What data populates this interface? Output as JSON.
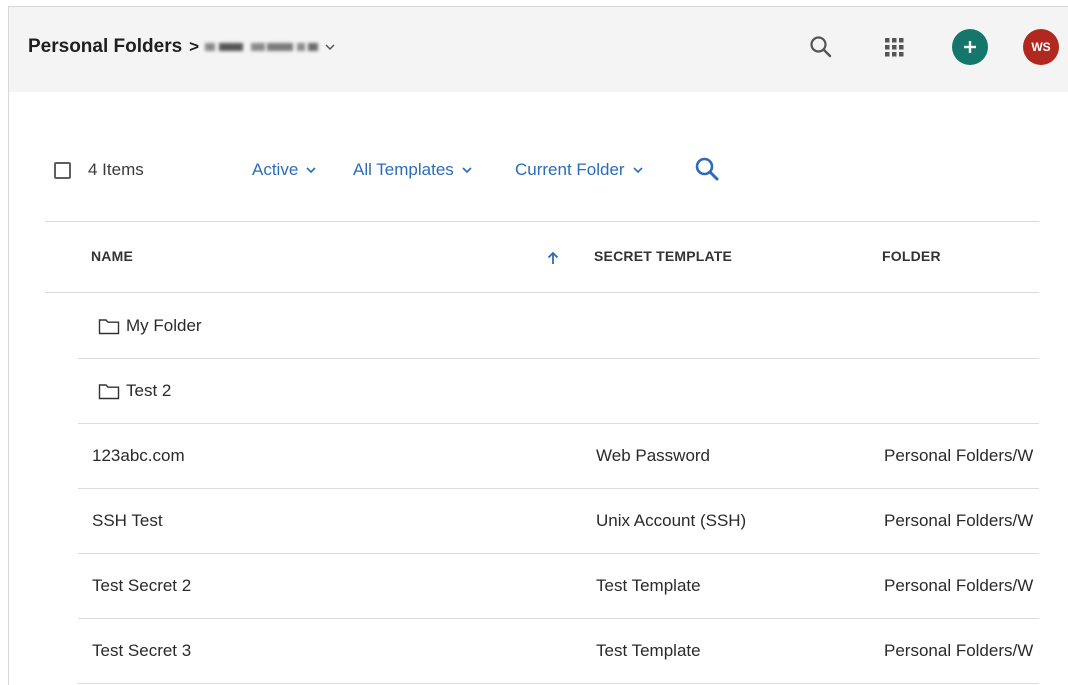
{
  "header": {
    "breadcrumb_root": "Personal Folders",
    "breadcrumb_separator": ">",
    "avatar_initials": "WS",
    "add_color": "#15776b",
    "avatar_color": "#b0281f"
  },
  "toolbar": {
    "items_count": "4 Items",
    "status_filter": "Active",
    "template_filter": "All Templates",
    "folder_filter": "Current Folder",
    "accent_color": "#2b6cb8"
  },
  "table": {
    "columns": {
      "name": "NAME",
      "template": "SECRET TEMPLATE",
      "folder": "FOLDER"
    },
    "sort": "name-ascending",
    "rows": [
      {
        "type": "folder",
        "name": "My Folder",
        "template": "",
        "folder": ""
      },
      {
        "type": "folder",
        "name": "Test 2",
        "template": "",
        "folder": ""
      },
      {
        "type": "secret",
        "name": "123abc.com",
        "template": "Web Password",
        "folder": "Personal Folders/W"
      },
      {
        "type": "secret",
        "name": "SSH Test",
        "template": "Unix Account (SSH)",
        "folder": "Personal Folders/W"
      },
      {
        "type": "secret",
        "name": "Test Secret 2",
        "template": "Test Template",
        "folder": "Personal Folders/W"
      },
      {
        "type": "secret",
        "name": "Test Secret 3",
        "template": "Test Template",
        "folder": "Personal Folders/W"
      }
    ]
  }
}
